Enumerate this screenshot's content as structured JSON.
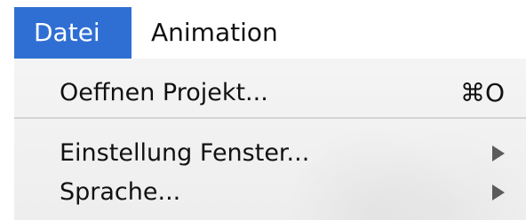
{
  "menubar": {
    "items": [
      {
        "label": "Datei"
      },
      {
        "label": "Animation"
      }
    ]
  },
  "menu": {
    "items": [
      {
        "label": "Oeffnen Projekt...",
        "shortcut": "⌘O"
      },
      {
        "label": "Einstellung Fenster..."
      },
      {
        "label": "Sprache..."
      }
    ]
  }
}
